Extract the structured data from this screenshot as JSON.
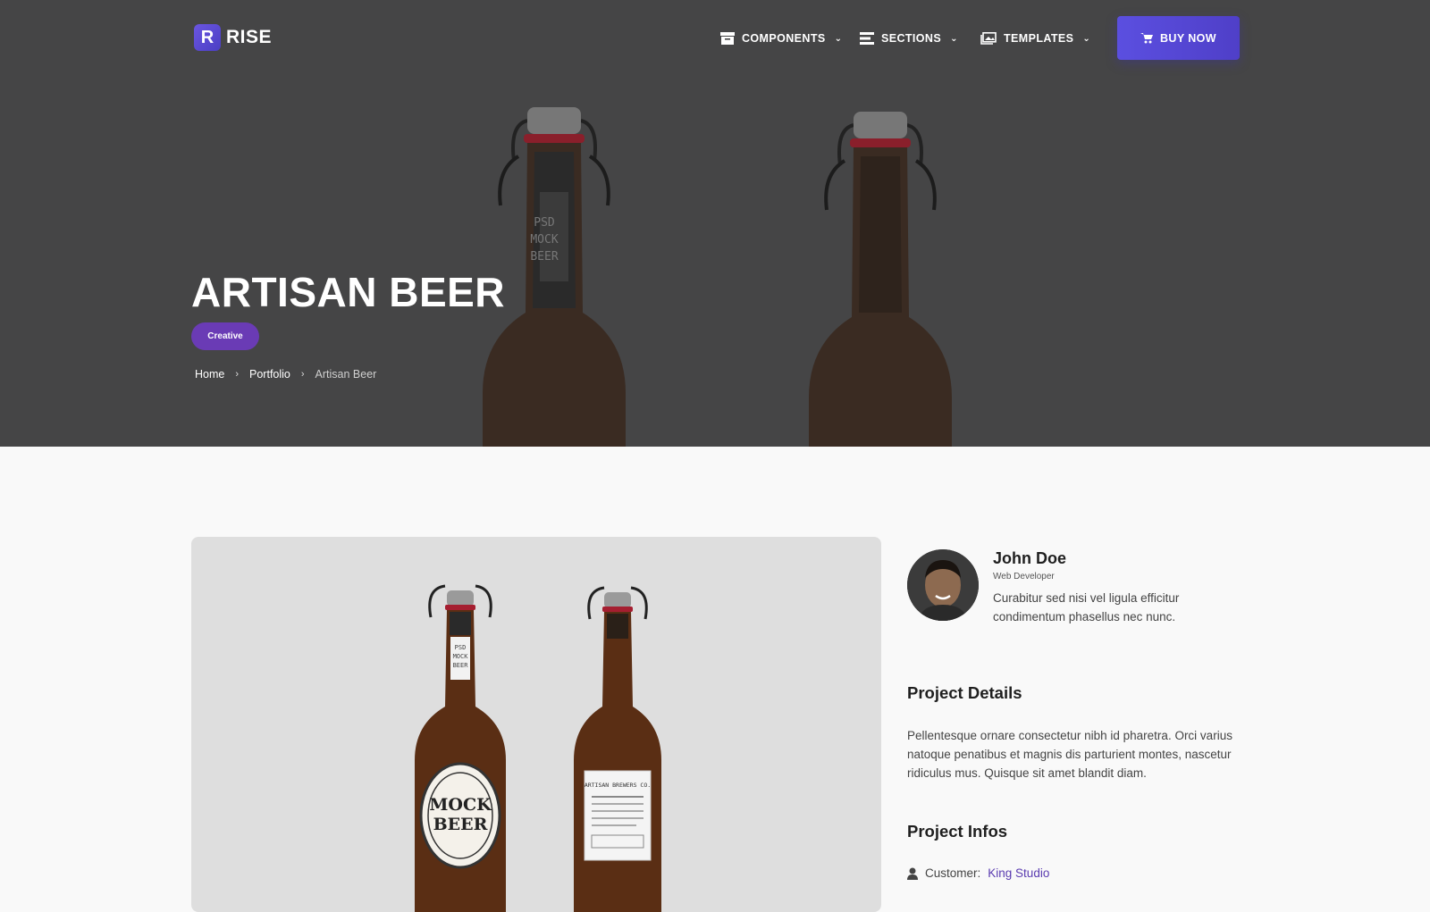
{
  "brand": {
    "mark": "R",
    "name": "RISE"
  },
  "nav": {
    "items": [
      {
        "label": "COMPONENTS",
        "icon": "archive-icon"
      },
      {
        "label": "SECTIONS",
        "icon": "list-icon"
      },
      {
        "label": "TEMPLATES",
        "icon": "images-icon"
      }
    ],
    "buy_label": "BUY NOW"
  },
  "hero": {
    "title": "ARTISAN BEER",
    "badge": "Creative",
    "breadcrumb": [
      "Home",
      "Portfolio",
      "Artisan Beer"
    ],
    "label_lines": [
      "PSD",
      "MOCK",
      "BEER"
    ]
  },
  "author": {
    "name": "John Doe",
    "role": "Web Developer",
    "bio": "Curabitur sed nisi vel ligula efficitur condimentum phasellus nec nunc."
  },
  "project_details": {
    "heading": "Project Details",
    "text": "Pellentesque ornare consectetur nibh id pharetra. Orci varius natoque penatibus et magnis dis parturient montes, nascetur ridiculus mus. Quisque sit amet blandit diam."
  },
  "project_infos": {
    "heading": "Project Infos",
    "customer_label": "Customer:",
    "customer_value": "King Studio"
  },
  "colors": {
    "accent": "#5b4fe0",
    "badge": "#6a3bb5",
    "hero_bg": "#454546"
  }
}
